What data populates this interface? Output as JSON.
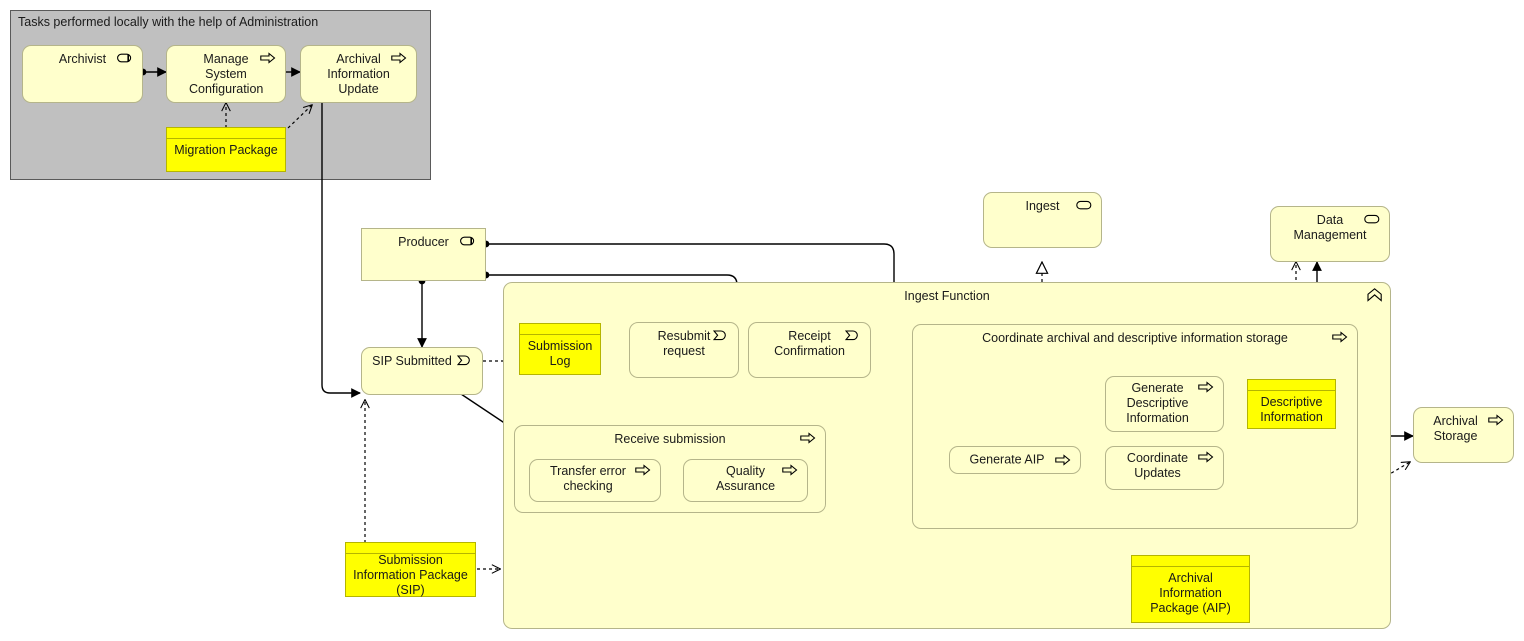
{
  "diagram": {
    "title": "OAIS Ingest Function ArchiMate diagram",
    "colors": {
      "element_fill": "#ffffcc",
      "object_fill": "#ffff00",
      "group_fill": "#c0c0c0",
      "line": "#000000",
      "element_border": "#b5b58a"
    }
  },
  "group": {
    "label": "Tasks performed locally with the help of Administration"
  },
  "nodes": {
    "archivist": {
      "label": "Archivist",
      "icon": "business-role-icon"
    },
    "manage_system_configuration": {
      "label": "Manage\nSystem\nConfiguration",
      "icon": "business-process-icon"
    },
    "archival_information_update": {
      "label": "Archival\nInformation\nUpdate",
      "icon": "business-process-icon"
    },
    "migration_package": {
      "label": "Migration Package",
      "icon": "business-object-icon"
    },
    "producer": {
      "label": "Producer",
      "icon": "business-role-icon"
    },
    "sip_submitted": {
      "label": "SIP Submitted",
      "icon": "business-event-icon"
    },
    "submission_log": {
      "label": "Submission\nLog",
      "icon": "business-object-icon"
    },
    "resubmit_request": {
      "label": "Resubmit\nrequest",
      "icon": "business-event-icon"
    },
    "receipt_confirmation": {
      "label": "Receipt\nConfirmation",
      "icon": "business-event-icon"
    },
    "submission_information_package": {
      "label": "Submission\nInformation Package\n(SIP)",
      "icon": "business-object-icon"
    },
    "ingest_function": {
      "label": "Ingest Function",
      "icon": "application-function-icon"
    },
    "receive_submission": {
      "label": "Receive submission",
      "icon": "business-process-icon"
    },
    "transfer_error_checking": {
      "label": "Transfer error\nchecking",
      "icon": "business-process-icon"
    },
    "quality_assurance": {
      "label": "Quality\nAssurance",
      "icon": "business-process-icon"
    },
    "coordinate_storage": {
      "label": "Coordinate archival and descriptive information storage",
      "icon": "business-process-icon"
    },
    "generate_aip": {
      "label": "Generate AIP",
      "icon": "business-process-icon"
    },
    "generate_descriptive_information": {
      "label": "Generate\nDescriptive\nInformation",
      "icon": "business-process-icon"
    },
    "coordinate_updates": {
      "label": "Coordinate\nUpdates",
      "icon": "business-process-icon"
    },
    "descriptive_information": {
      "label": "Descriptive\nInformation",
      "icon": "business-object-icon"
    },
    "archival_information_package": {
      "label": "Archival Information\nPackage (AIP)",
      "icon": "business-object-icon"
    },
    "ingest": {
      "label": "Ingest",
      "icon": "business-service-icon"
    },
    "data_management": {
      "label": "Data\nManagement",
      "icon": "business-service-icon"
    },
    "archival_storage": {
      "label": "Archival\nStorage",
      "icon": "business-process-icon"
    }
  }
}
